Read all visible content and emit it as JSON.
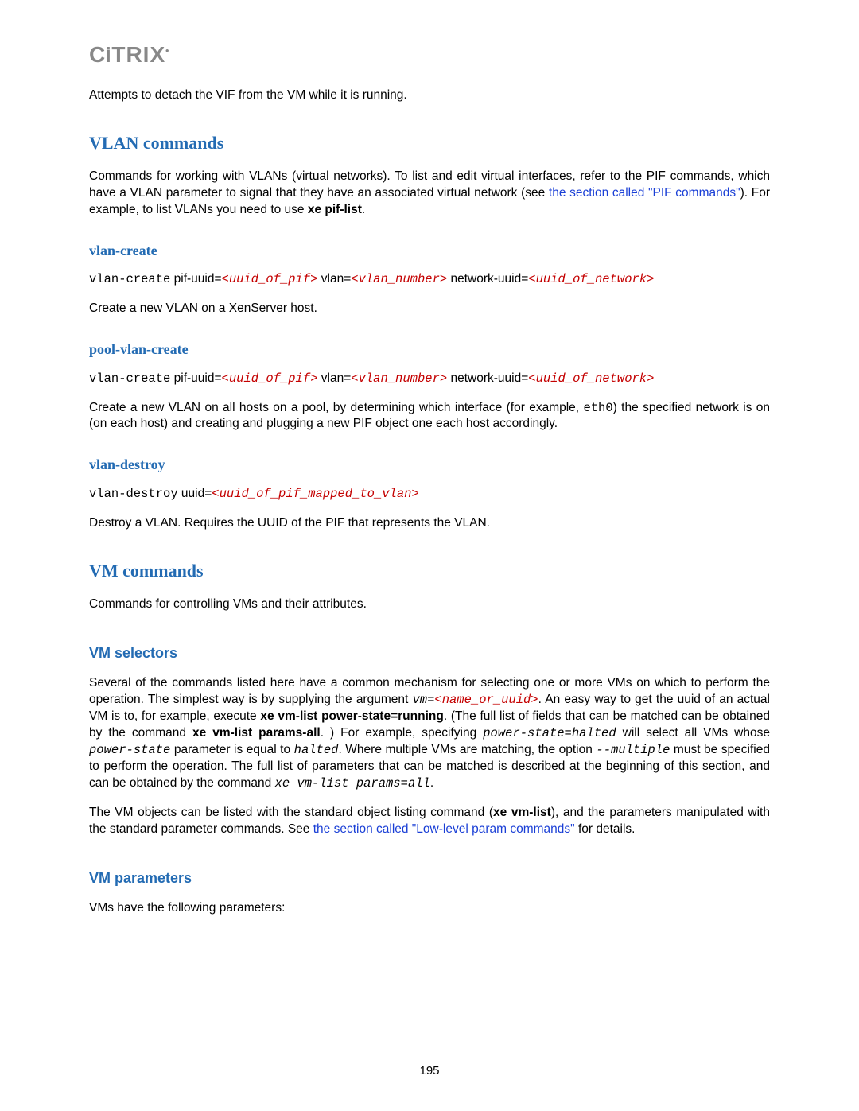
{
  "logo": "CİTRIX",
  "intro_line": "Attempts to detach the VIF from the VM while it is running.",
  "vlan": {
    "heading": "VLAN commands",
    "intro_a": "Commands for working with VLANs (virtual networks). To list and edit virtual interfaces, refer to the PIF commands, which have a VLAN parameter to signal that they have an associated virtual network (see ",
    "intro_link": "the section called \"PIF commands\"",
    "intro_b": "). For example, to list VLANs you need to use ",
    "intro_cmd": "xe pif-list",
    "intro_c": ".",
    "create": {
      "heading": "vlan-create",
      "cmd": "vlan-create",
      "p1_label": " pif-uuid=",
      "p1_val": "<uuid_of_pif>",
      "p2_label": " vlan=",
      "p2_val": "<vlan_number>",
      "p3_label": " network-uuid=",
      "p3_val": "<uuid_of_network>",
      "desc": "Create a new VLAN on a XenServer host."
    },
    "pool_create": {
      "heading": "pool-vlan-create",
      "cmd": "vlan-create",
      "p1_label": " pif-uuid=",
      "p1_val": "<uuid_of_pif>",
      "p2_label": " vlan=",
      "p2_val": "<vlan_number>",
      "p3_label": " network-uuid=",
      "p3_val": "<uuid_of_network>",
      "desc_a": "Create a new VLAN on all hosts on a pool, by determining which interface (for example, ",
      "desc_code": "eth0",
      "desc_b": ") the specified network is on (on each host) and creating and plugging a new PIF object one each host accordingly."
    },
    "destroy": {
      "heading": "vlan-destroy",
      "cmd": "vlan-destroy",
      "p1_label": " uuid=",
      "p1_val": "<uuid_of_pif_mapped_to_vlan>",
      "desc": "Destroy a VLAN. Requires the UUID of the PIF that represents the VLAN."
    }
  },
  "vm": {
    "heading": "VM commands",
    "intro": "Commands for controlling VMs and their attributes.",
    "selectors": {
      "heading": "VM selectors",
      "p1_a": "Several of the commands listed here have a common mechanism for selecting one or more VMs on which to perform the operation. The simplest way is by supplying the argument ",
      "p1_vm": "vm=",
      "p1_vmval": "<name_or_uuid>",
      "p1_b": ". An easy way to get the uuid of an actual VM is to, for example, execute ",
      "p1_bold1": "xe vm-list power-state=running",
      "p1_c": ". (The full list of fields that can be matched can be obtained by the command ",
      "p1_bold2": "xe vm-list params-all",
      "p1_d": ". ) For example, specifying ",
      "p1_ps": "power-state=halted",
      "p1_e": " will select all VMs whose ",
      "p1_ps2": "power-state",
      "p1_f": " parameter is equal to ",
      "p1_halted": "halted",
      "p1_g": ". Where multiple VMs are matching, the option ",
      "p1_multi": "--multiple",
      "p1_h": " must be specified to perform the operation. The full list of parameters that can be matched is described at the beginning of this section, and can be obtained by the command ",
      "p1_listcmd": "xe vm-list params=all",
      "p1_i": ".",
      "p2_a": "The VM objects can be listed with the standard object listing command (",
      "p2_bold": "xe vm-list",
      "p2_b": "), and the parameters manipulated with the standard parameter commands. See ",
      "p2_link": "the section called \"Low-level param commands\"",
      "p2_c": " for details."
    },
    "params": {
      "heading": "VM parameters",
      "desc": "VMs have the following parameters:"
    }
  },
  "pagenum": "195"
}
